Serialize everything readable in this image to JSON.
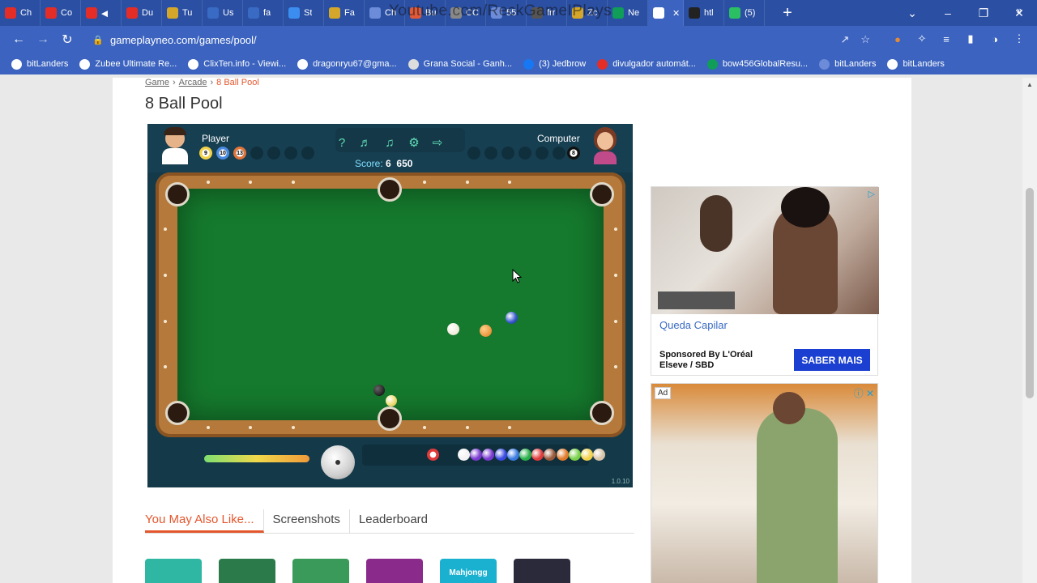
{
  "browser": {
    "watermark": "Youtube.com/ReckGameIPlays",
    "tabs": [
      {
        "label": "Ch",
        "color": "#e52d27"
      },
      {
        "label": "Co",
        "color": "#e52d27"
      },
      {
        "label": "◀",
        "color": "#e52d27"
      },
      {
        "label": "Du",
        "color": "#e52d27"
      },
      {
        "label": "Tu",
        "color": "#d4a62a"
      },
      {
        "label": "Us",
        "color": "#3a6bc4"
      },
      {
        "label": "fa",
        "color": "#3a6bc4"
      },
      {
        "label": "St",
        "color": "#3b8ef0"
      },
      {
        "label": "Fa",
        "color": "#d4a62a"
      },
      {
        "label": "Ch",
        "color": "#6c8bd8"
      },
      {
        "label": "Bu",
        "color": "#e05a3a"
      },
      {
        "label": "CC",
        "color": "#888888"
      },
      {
        "label": "55",
        "color": "#6c8bd8"
      },
      {
        "label": "frr",
        "color": "#555555"
      },
      {
        "label": "Zc",
        "color": "#d4a62a"
      },
      {
        "label": "Ne",
        "color": "#0f9d58"
      },
      {
        "label": "I",
        "color": "#ffffff"
      },
      {
        "label": "htl",
        "color": "#222222"
      },
      {
        "label": "(5)",
        "color": "#2bbf63"
      }
    ],
    "new_tab": "+",
    "window_controls": {
      "dropdown": "⌄",
      "minimize": "–",
      "restore": "❐",
      "close": "✕"
    },
    "url": "gameplayneo.com/games/pool/",
    "bookmarks": [
      {
        "label": "bitLanders",
        "color": "#ffffff"
      },
      {
        "label": "Zubee Ultimate Re...",
        "color": "#ffffff"
      },
      {
        "label": "ClixTen.info - Viewi...",
        "color": "#ffffff"
      },
      {
        "label": "dragonryu67@gma...",
        "color": "#ffffff"
      },
      {
        "label": "Grana Social - Ganh...",
        "color": "#dddddd"
      },
      {
        "label": "(3) Jedbrow",
        "color": "#1877f2"
      },
      {
        "label": "divulgador automát...",
        "color": "#e52d27"
      },
      {
        "label": "bow456GlobalResu...",
        "color": "#0f9d58"
      },
      {
        "label": "bitLanders",
        "color": "#6c8bd8"
      },
      {
        "label": "bitLanders",
        "color": "#ffffff"
      }
    ],
    "bookmarks_more": "»"
  },
  "page": {
    "breadcrumb": [
      "Game",
      "Arcade",
      "8 Ball Pool"
    ],
    "title": "8 Ball Pool",
    "tabs": [
      "You May Also Like...",
      "Screenshots",
      "Leaderboard"
    ],
    "thumbs": [
      {
        "color": "#2fb7a3",
        "label": ""
      },
      {
        "color": "#2a7a4a",
        "label": ""
      },
      {
        "color": "#3a9a5a",
        "label": ""
      },
      {
        "color": "#8a2a8a",
        "label": ""
      },
      {
        "color": "#1ab0d0",
        "label": "Mahjongg"
      },
      {
        "color": "#2a2a3a",
        "label": ""
      }
    ]
  },
  "game": {
    "player_name": "Player",
    "computer_name": "Computer",
    "score_label": "Score:",
    "score_value": "6",
    "score_points": "650",
    "player_balls": [
      {
        "num": "9",
        "color": "#f2d24a"
      },
      {
        "num": "10",
        "color": "#4a8ae0"
      },
      {
        "num": "13",
        "color": "#e0743a"
      }
    ],
    "computer_balls": [
      {
        "num": "8",
        "color": "#111111"
      }
    ],
    "version": "1.0.10",
    "rack_colors": [
      "#f2f2f2",
      "#7a3ad0",
      "#7a3ad0",
      "#3a4ae0",
      "#3a7ae0",
      "#2ab04a",
      "#e03a3a",
      "#9a5a3a",
      "#e07a2a",
      "#7ad04a",
      "#f2d24a",
      "#d8c4a8"
    ],
    "rack_first": "#e03a3a"
  },
  "ads": {
    "ad1_headline": "Queda Capilar",
    "ad1_sponsor": "Sponsored By L'Oréal Elseve / SBD",
    "ad1_cta": "SABER MAIS",
    "ad2_label": "Ad"
  }
}
